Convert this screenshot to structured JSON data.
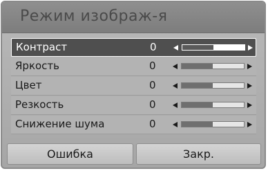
{
  "dialog": {
    "title": "Режим изображ-я"
  },
  "settings": [
    {
      "label": "Контраст",
      "value": "0",
      "level": 0.5,
      "selected": true
    },
    {
      "label": "Яркость",
      "value": "0",
      "level": 0.5,
      "selected": false
    },
    {
      "label": "Цвет",
      "value": "0",
      "level": 0.5,
      "selected": false
    },
    {
      "label": "Резкость",
      "value": "0",
      "level": 0.5,
      "selected": false
    },
    {
      "label": "Снижение шума",
      "value": "0",
      "level": 0.5,
      "selected": false
    }
  ],
  "buttons": {
    "error_label": "Ошибка",
    "close_label": "Закр."
  },
  "colors": {
    "selected_row": "#4f4f4f",
    "panel": "#b3b3b3",
    "title_bar": "#8a8a8a"
  },
  "icons": {
    "decrease": "arrow-left-icon",
    "increase": "arrow-right-icon"
  }
}
